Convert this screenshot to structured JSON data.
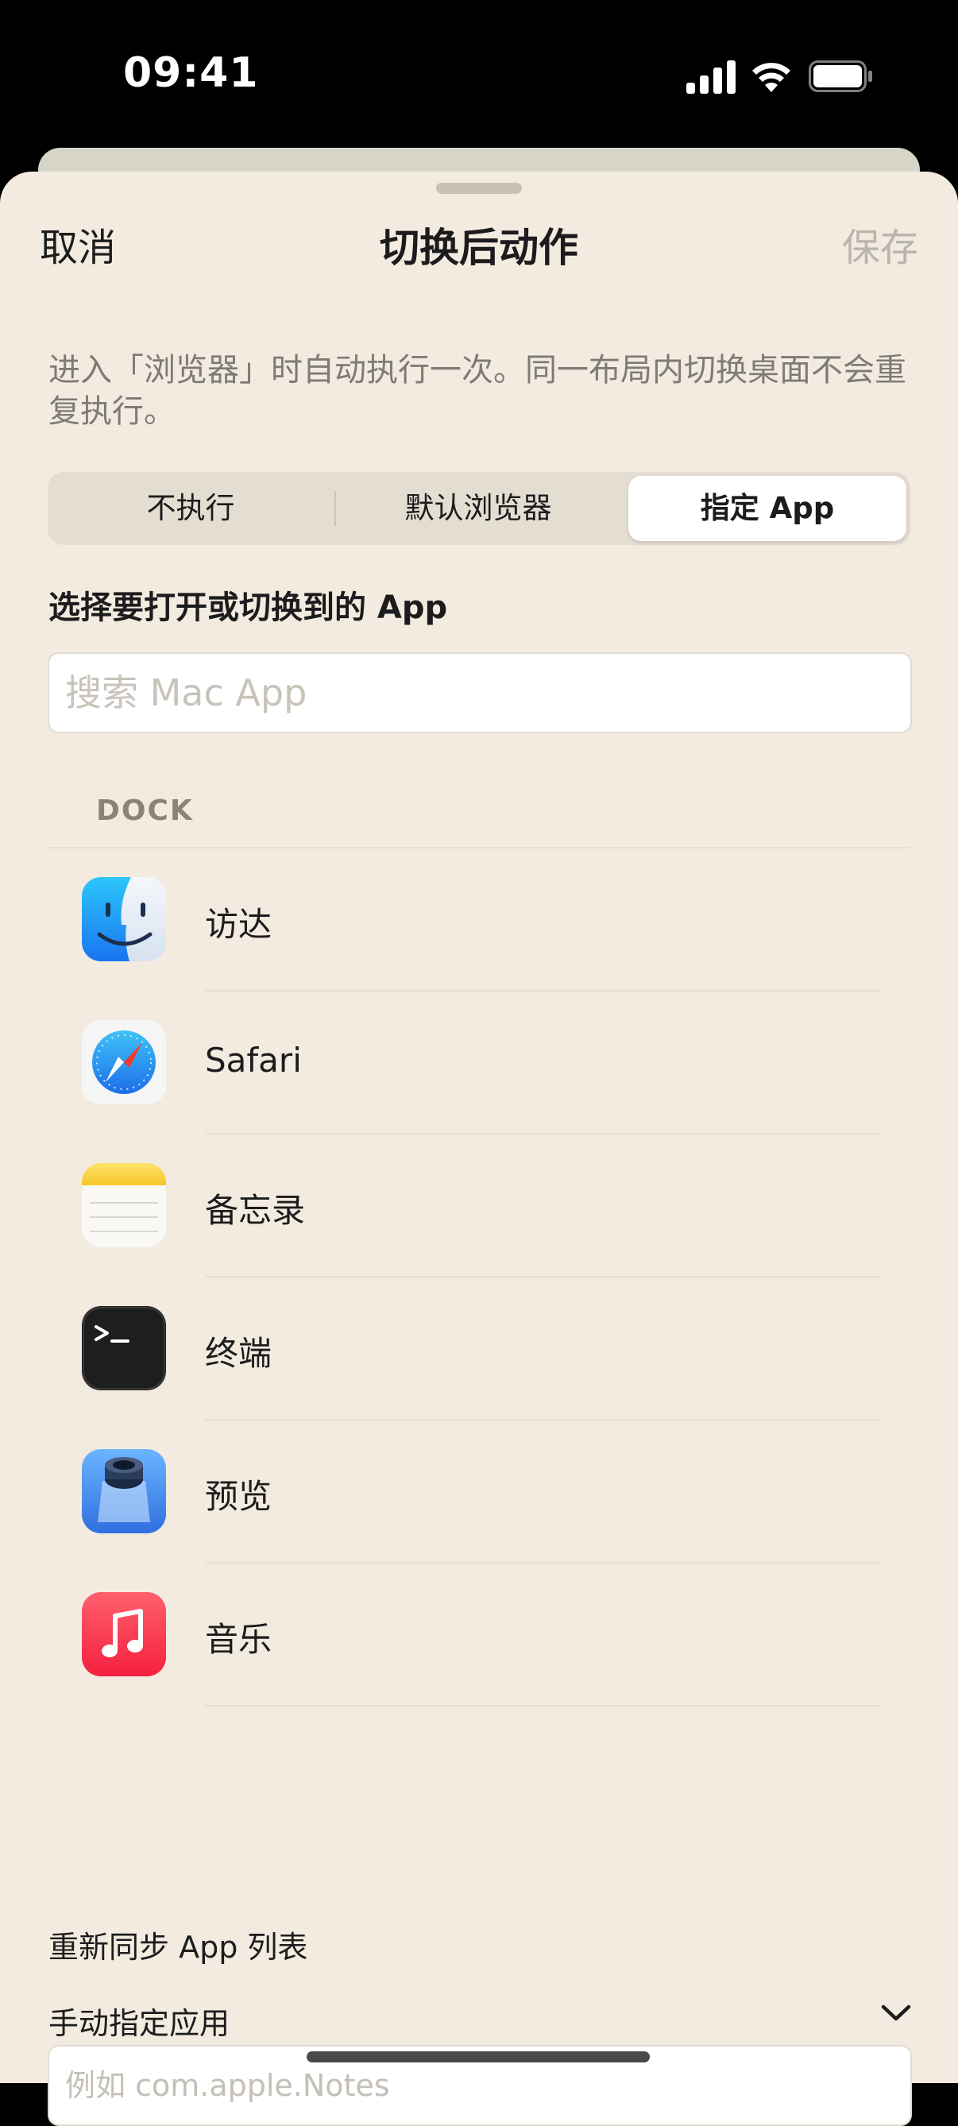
{
  "status_bar": {
    "time": "09:41"
  },
  "nav": {
    "cancel": "取消",
    "title": "切换后动作",
    "save": "保存"
  },
  "description": "进入「浏览器」时自动执行一次。同一布局内切换桌面不会重复执行。",
  "segmented": {
    "options": [
      "不执行",
      "默认浏览器",
      "指定 App"
    ],
    "selected": "指定 App"
  },
  "section_label": "选择要打开或切换到的 App",
  "search": {
    "placeholder": "搜索 Mac App",
    "value": ""
  },
  "dock": {
    "header": "DOCK",
    "apps": [
      {
        "name": "访达",
        "icon": "finder-icon"
      },
      {
        "name": "Safari",
        "icon": "safari-icon"
      },
      {
        "name": "备忘录",
        "icon": "notes-icon"
      },
      {
        "name": "终端",
        "icon": "terminal-icon"
      },
      {
        "name": "预览",
        "icon": "preview-icon"
      },
      {
        "name": "音乐",
        "icon": "music-icon"
      }
    ]
  },
  "resync_label": "重新同步 App 列表",
  "manual": {
    "label": "手动指定应用",
    "placeholder": "例如 com.apple.Notes",
    "value": ""
  },
  "colors": {
    "sheet_background": "#f3ebdf",
    "segment_selected": "#ffffff",
    "save_disabled": "#b9b5ad"
  }
}
